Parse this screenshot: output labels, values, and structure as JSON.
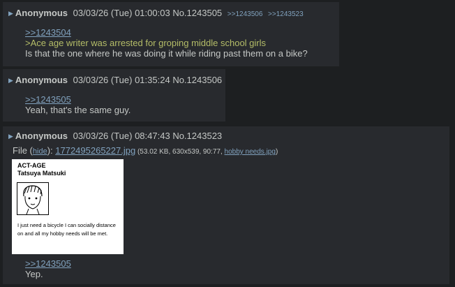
{
  "posts": [
    {
      "name": "Anonymous",
      "datetime": "03/03/26 (Tue) 01:00:03",
      "postno": "No.1243505",
      "backlinks": [
        ">>1243506",
        ">>1243523"
      ],
      "quote_link": ">>1243504",
      "greentext": ">Ace age writer was arrested for groping middle school girls",
      "text": "Is that the one where he was doing it while riding past them on a bike?"
    },
    {
      "name": "Anonymous",
      "datetime": "03/03/26 (Tue) 01:35:24",
      "postno": "No.1243506",
      "quote_link": ">>1243505",
      "text": "Yeah, that's the same guy."
    },
    {
      "name": "Anonymous",
      "datetime": "03/03/26 (Tue) 08:47:43",
      "postno": "No.1243523",
      "file": {
        "prefix": "File (",
        "hide_label": "hide",
        "mid": "): ",
        "filename": "1772495265227.jpg",
        "meta": " (53.02 KB, 630x539, 90:77, ",
        "original_name": "hobby needs.jpg",
        "suffix": ")"
      },
      "thumbnail": {
        "title": "ACT-AGE",
        "subtitle": "Tatsuya Matsuki",
        "caption": "I just need a bicycle I can socially distance on and all my hobby needs will be met."
      },
      "quote_link": ">>1243505",
      "text": "Yep."
    }
  ],
  "colors": {
    "background": "#1d1f21",
    "post_bg": "#282a2e",
    "text": "#c5c8c6",
    "link": "#81a2be",
    "greentext": "#b5bd68"
  },
  "icons": {
    "expand": "triangle-right-icon"
  }
}
